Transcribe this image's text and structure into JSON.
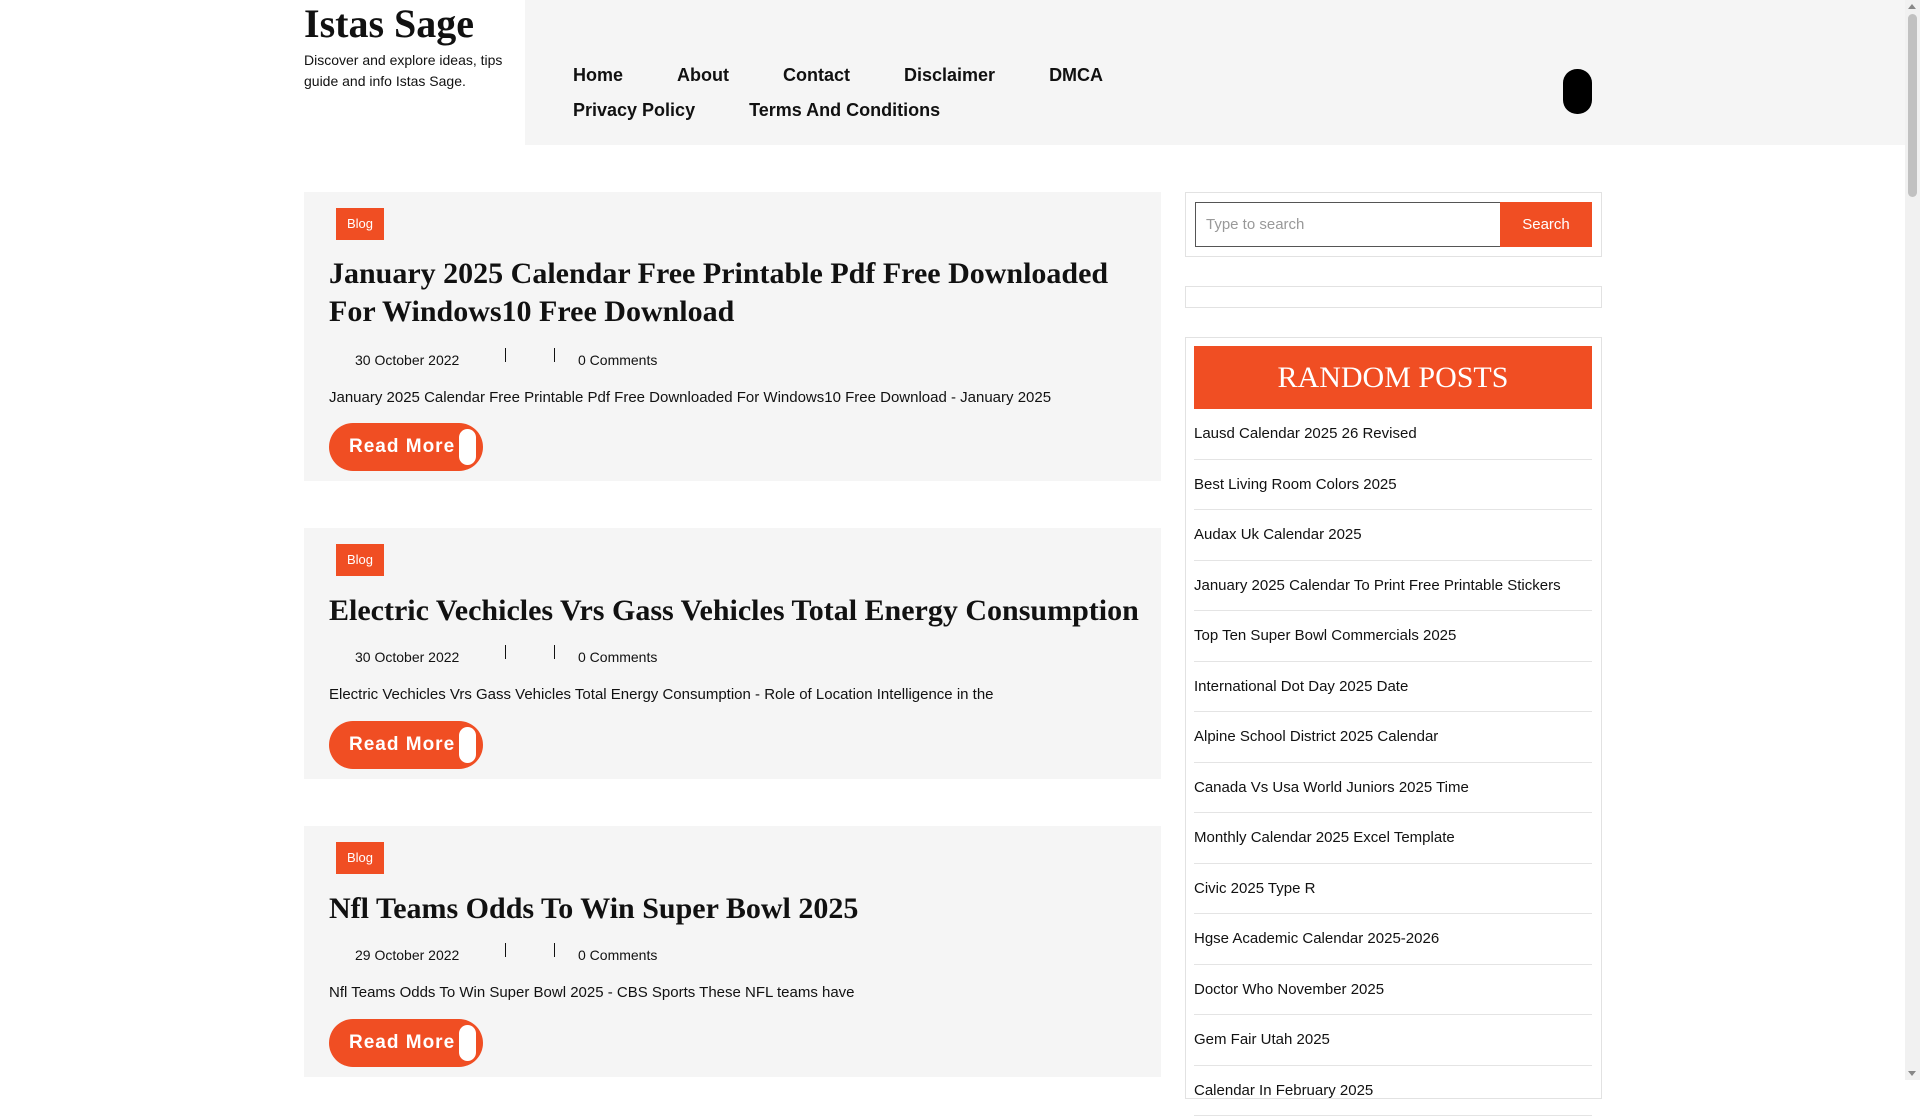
{
  "site": {
    "title": "Istas Sage",
    "description": "Discover and explore ideas, tips guide and info Istas Sage."
  },
  "nav": {
    "items": [
      {
        "label": "Home"
      },
      {
        "label": "About"
      },
      {
        "label": "Contact"
      },
      {
        "label": "Disclaimer"
      },
      {
        "label": "DMCA"
      },
      {
        "label": "Privacy Policy"
      },
      {
        "label": "Terms And Conditions"
      }
    ]
  },
  "posts": [
    {
      "category": "Blog",
      "title": "January 2025 Calendar Free Printable Pdf Free Downloaded For Windows10 Free Download",
      "date": "30 October 2022",
      "comments": "0 Comments",
      "excerpt": "January 2025 Calendar Free Printable Pdf Free Downloaded For Windows10 Free Download - January 2025",
      "read_more": "Read More"
    },
    {
      "category": "Blog",
      "title": "Electric Vechicles Vrs Gass Vehicles Total Energy Consumption",
      "date": "30 October 2022",
      "comments": "0 Comments",
      "excerpt": "Electric Vechicles Vrs Gass Vehicles Total Energy Consumption - Role of Location Intelligence in the",
      "read_more": "Read More"
    },
    {
      "category": "Blog",
      "title": "Nfl Teams Odds To Win Super Bowl 2025",
      "date": "29 October 2022",
      "comments": "0 Comments",
      "excerpt": "Nfl Teams Odds To Win Super Bowl 2025 - CBS Sports These NFL teams have",
      "read_more": "Read More"
    }
  ],
  "sidebar": {
    "search": {
      "placeholder": "Type to search",
      "button": "Search"
    },
    "random_posts": {
      "heading": "RANDOM POSTS",
      "items": [
        "Lausd Calendar 2025 26 Revised",
        "Best Living Room Colors 2025",
        "Audax Uk Calendar 2025",
        "January 2025 Calendar To Print Free Printable Stickers",
        "Top Ten Super Bowl Commercials 2025",
        "International Dot Day 2025 Date",
        "Alpine School District 2025 Calendar",
        "Canada Vs Usa World Juniors 2025 Time",
        "Monthly Calendar 2025 Excel Template",
        "Civic 2025 Type R",
        "Hgse Academic Calendar 2025-2026",
        "Doctor Who November 2025",
        "Gem Fair Utah 2025",
        "Calendar In February 2025"
      ]
    }
  },
  "colors": {
    "accent": "#f04e23",
    "nav_background": "#f5f5f5",
    "card_background": "#f5f5f5"
  }
}
